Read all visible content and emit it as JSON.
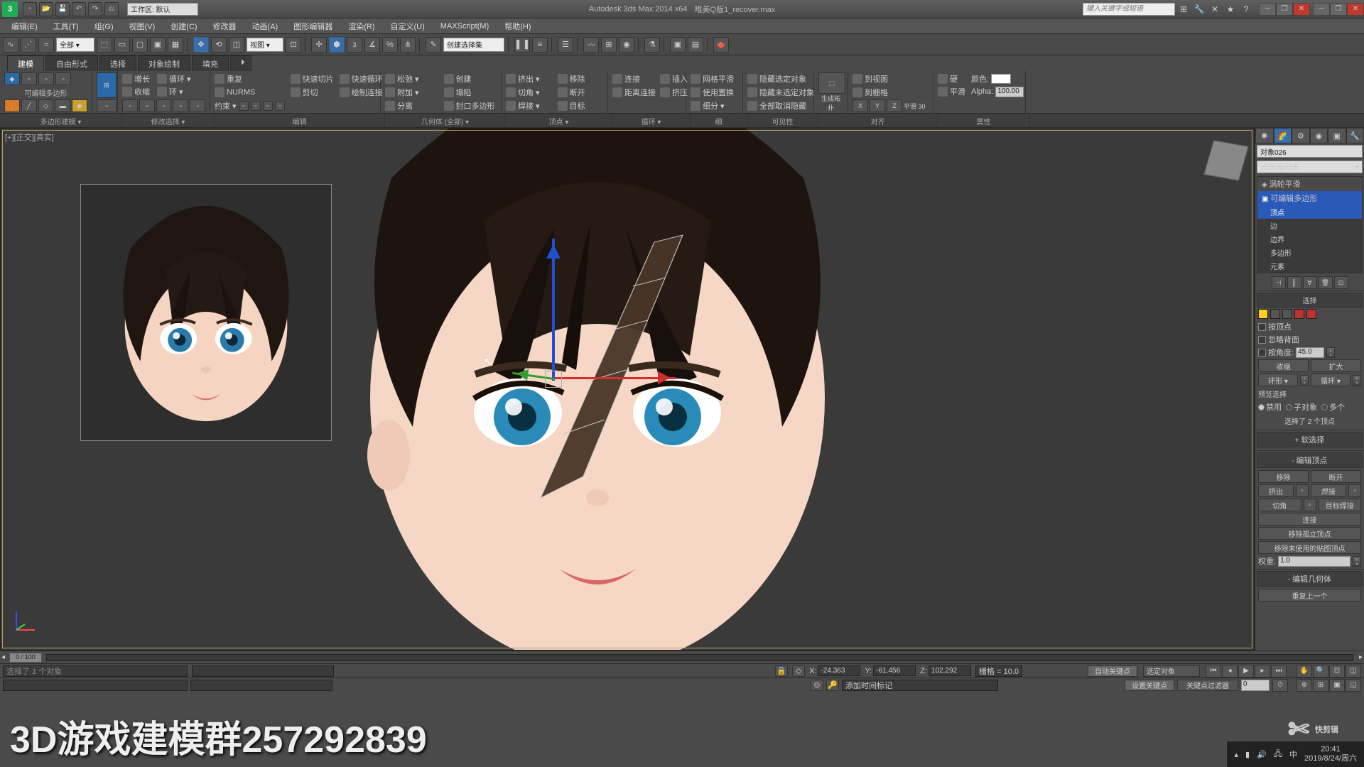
{
  "app": {
    "title": "Autodesk 3ds Max 2014 x64",
    "document": "唯美Q版1_recover.max",
    "workspace_label": "工作区: 默认",
    "search_placeholder": "键入关键字或短语"
  },
  "menu": [
    "编辑(E)",
    "工具(T)",
    "组(G)",
    "视图(V)",
    "创建(C)",
    "修改器",
    "动画(A)",
    "图形编辑器",
    "渲染(R)",
    "自定义(U)",
    "MAXScript(M)",
    "帮助(H)"
  ],
  "toolbar": {
    "all_drop": "全部 ▾",
    "view_drop": "视图  ▾",
    "named_sel": "创建选择集"
  },
  "ribbon": {
    "tabs": [
      "建模",
      "自由形式",
      "选择",
      "对象绘制",
      "填充"
    ],
    "strip": [
      "多边形建模 ▾",
      "修改选择 ▾",
      "编辑",
      "几何体 (全部) ▾",
      "顶点 ▾",
      "循环 ▾",
      "细分",
      "可见性",
      "对齐",
      "属性"
    ],
    "group1_label": "可编辑多边形",
    "cmds_col2a": [
      "增长",
      "收缩"
    ],
    "cmds_col2b": "循环 ▾",
    "cmds_col2c": "环 ▾",
    "cmds_col3": [
      "重复",
      "快速切片",
      "快速循环",
      "NURMS",
      "剪切",
      "绘制连接",
      "约束 ▾"
    ],
    "cmds_col4": [
      "松弛 ▾",
      "创建",
      "附加 ▾",
      "塌陷",
      "分离",
      "封口多边形"
    ],
    "cmds_col5": [
      "挤出 ▾",
      "移除",
      "切角 ▾",
      "断开",
      "焊接 ▾",
      "目标"
    ],
    "cmds_col6": [
      "连接",
      "插入",
      "距离连接",
      "挤压"
    ],
    "cmds_col7": [
      "网格平滑",
      "使用置换",
      "细分 ▾"
    ],
    "cmds_col8": [
      "隐藏选定对象",
      "隐藏未选定对象",
      "全部取消隐藏"
    ],
    "cmds_col9": "生成拓扑",
    "cmds_col10": [
      "到视图",
      "到栅格",
      "X",
      "Y",
      "Z",
      "平滑 30"
    ],
    "cmds_col11": [
      "硬",
      "平滑",
      "颜色:",
      "Alpha:",
      "100.00"
    ]
  },
  "viewport": {
    "label": "[+][正交][真实]"
  },
  "cmd_panel": {
    "object_name": "对象026",
    "modifier_drop": "修改器列表",
    "stack": [
      "涡轮平滑",
      "可编辑多边形"
    ],
    "subobj": [
      "顶点",
      "边",
      "边界",
      "多边形",
      "元素"
    ],
    "sel_section": "选择",
    "sel_opts": [
      "按顶点",
      "忽略背面",
      "按角度:"
    ],
    "angle_val": "45.0",
    "shrink": "收缩",
    "grow": "扩大",
    "ring": "环形 ▾",
    "loop": "循环 ▾",
    "preview": "预览选择",
    "preview_opts": [
      "禁用",
      "子对象",
      "多个"
    ],
    "sel_status": "选择了 2 个顶点",
    "soft_sel": "软选择",
    "edit_verts": "编辑顶点",
    "ev_btns": [
      [
        "移除",
        "断开"
      ],
      [
        "挤出",
        "焊接"
      ],
      [
        "切角",
        "目标焊接"
      ]
    ],
    "connect": "连接",
    "rm_iso": "移除孤立顶点",
    "rm_unused": "移除未使用的贴图顶点",
    "weight": "权重:",
    "weight_val": "1.0",
    "edit_geo": "编辑几何体",
    "repeat": "重复上一个"
  },
  "timeline": {
    "frame": "0 / 100"
  },
  "status": {
    "sel_info": "选择了 1 个对象",
    "x": "-24.363",
    "y": "-61.456",
    "z": "102.292",
    "grid": "栅格 = 10.0",
    "auto_key": "自动关键点",
    "set_key": "设置关键点",
    "add_time": "添加时间标记",
    "sel_label": "选定对象",
    "key_filter": "关键点过滤器"
  },
  "overlay": "3D游戏建模群257292839",
  "watermark": "快剪辑",
  "clock": {
    "time": "20:41",
    "date": "2019/8/24/周六"
  }
}
